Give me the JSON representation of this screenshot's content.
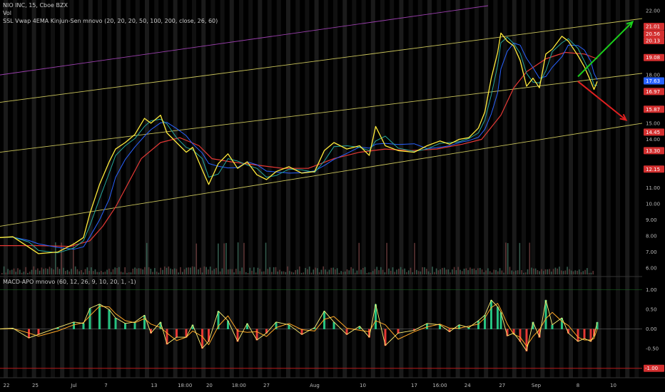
{
  "header": {
    "symbol_line": "NIO INC, 15, Cboe BZX",
    "vol_label": "Vol",
    "indicator_line": "SSL Vwap 4EMA Kinjun-Sen mnovo (20, 20, 20, 50, 100, 200, close, 26, 60)",
    "macd_label": "MACD-APO mnovo (60, 12, 26, 9, 10, 20, 1, -1)"
  },
  "chart_data": {
    "type": "line",
    "price_axis": {
      "ticks": [
        "22.00",
        "21.01",
        "20.56",
        "20.13",
        "19.08",
        "18.00",
        "17.63",
        "16.97",
        "15.87",
        "15.00",
        "14.45",
        "14.00",
        "13.30",
        "12.15",
        "11.00",
        "10.00",
        "9.00",
        "8.00",
        "7.00",
        "6.00"
      ],
      "tag_colors": {
        "21.01": "#d32f2f",
        "20.56": "#d32f2f",
        "20.13": "#d32f2f",
        "19.08": "#d32f2f",
        "17.63": "#2962ff",
        "16.97": "#d32f2f",
        "15.87": "#d32f2f",
        "14.45": "#d32f2f",
        "13.30": "#d32f2f",
        "12.15": "#d32f2f"
      },
      "ylim": [
        5.7,
        22.3
      ]
    },
    "macd_axis": {
      "ticks": [
        "1.00",
        "0.50",
        "0.00",
        "-0.50",
        "-1.00"
      ],
      "tag_colors": {
        "-1.00": "#d32f2f"
      },
      "ylim": [
        -1.15,
        1.15
      ]
    },
    "x_ticks": [
      {
        "label": "22",
        "t": 0.01
      },
      {
        "label": "25",
        "t": 0.055
      },
      {
        "label": "Jul",
        "t": 0.115
      },
      {
        "label": "7",
        "t": 0.165
      },
      {
        "label": "13",
        "t": 0.24
      },
      {
        "label": "18:00",
        "t": 0.288
      },
      {
        "label": "20",
        "t": 0.326
      },
      {
        "label": "18:00",
        "t": 0.372
      },
      {
        "label": "27",
        "t": 0.415
      },
      {
        "label": "Aug",
        "t": 0.49
      },
      {
        "label": "10",
        "t": 0.565
      },
      {
        "label": "17",
        "t": 0.645
      },
      {
        "label": "16:00",
        "t": 0.685
      },
      {
        "label": "24",
        "t": 0.728
      },
      {
        "label": "27",
        "t": 0.782
      },
      {
        "label": "Sep",
        "t": 0.835
      },
      {
        "label": "8",
        "t": 0.9
      },
      {
        "label": "10",
        "t": 0.955
      }
    ],
    "price_series": [
      {
        "t": 0.0,
        "v": 7.9
      },
      {
        "t": 0.02,
        "v": 7.95
      },
      {
        "t": 0.045,
        "v": 7.3
      },
      {
        "t": 0.06,
        "v": 6.9
      },
      {
        "t": 0.09,
        "v": 7.0
      },
      {
        "t": 0.115,
        "v": 7.5
      },
      {
        "t": 0.13,
        "v": 7.9
      },
      {
        "t": 0.14,
        "v": 9.4
      },
      {
        "t": 0.155,
        "v": 11.2
      },
      {
        "t": 0.17,
        "v": 12.6
      },
      {
        "t": 0.18,
        "v": 13.4
      },
      {
        "t": 0.195,
        "v": 13.8
      },
      {
        "t": 0.21,
        "v": 14.3
      },
      {
        "t": 0.225,
        "v": 15.3
      },
      {
        "t": 0.235,
        "v": 15.0
      },
      {
        "t": 0.25,
        "v": 15.5
      },
      {
        "t": 0.26,
        "v": 14.4
      },
      {
        "t": 0.275,
        "v": 13.8
      },
      {
        "t": 0.29,
        "v": 13.2
      },
      {
        "t": 0.3,
        "v": 13.5
      },
      {
        "t": 0.315,
        "v": 12.1
      },
      {
        "t": 0.325,
        "v": 11.2
      },
      {
        "t": 0.34,
        "v": 12.5
      },
      {
        "t": 0.355,
        "v": 13.1
      },
      {
        "t": 0.37,
        "v": 12.2
      },
      {
        "t": 0.385,
        "v": 12.6
      },
      {
        "t": 0.4,
        "v": 11.8
      },
      {
        "t": 0.415,
        "v": 11.5
      },
      {
        "t": 0.43,
        "v": 12.0
      },
      {
        "t": 0.45,
        "v": 12.3
      },
      {
        "t": 0.47,
        "v": 11.9
      },
      {
        "t": 0.49,
        "v": 12.0
      },
      {
        "t": 0.505,
        "v": 13.3
      },
      {
        "t": 0.52,
        "v": 13.8
      },
      {
        "t": 0.54,
        "v": 13.4
      },
      {
        "t": 0.56,
        "v": 13.6
      },
      {
        "t": 0.575,
        "v": 13.0
      },
      {
        "t": 0.585,
        "v": 14.8
      },
      {
        "t": 0.6,
        "v": 13.6
      },
      {
        "t": 0.62,
        "v": 13.3
      },
      {
        "t": 0.645,
        "v": 13.2
      },
      {
        "t": 0.665,
        "v": 13.6
      },
      {
        "t": 0.685,
        "v": 13.9
      },
      {
        "t": 0.7,
        "v": 13.7
      },
      {
        "t": 0.715,
        "v": 14.0
      },
      {
        "t": 0.73,
        "v": 14.1
      },
      {
        "t": 0.745,
        "v": 14.7
      },
      {
        "t": 0.755,
        "v": 15.7
      },
      {
        "t": 0.765,
        "v": 17.8
      },
      {
        "t": 0.775,
        "v": 19.4
      },
      {
        "t": 0.78,
        "v": 20.6
      },
      {
        "t": 0.79,
        "v": 20.1
      },
      {
        "t": 0.8,
        "v": 19.8
      },
      {
        "t": 0.81,
        "v": 18.9
      },
      {
        "t": 0.82,
        "v": 17.3
      },
      {
        "t": 0.83,
        "v": 17.8
      },
      {
        "t": 0.84,
        "v": 17.2
      },
      {
        "t": 0.85,
        "v": 19.3
      },
      {
        "t": 0.86,
        "v": 19.6
      },
      {
        "t": 0.875,
        "v": 20.4
      },
      {
        "t": 0.885,
        "v": 20.1
      },
      {
        "t": 0.9,
        "v": 19.2
      },
      {
        "t": 0.91,
        "v": 18.5
      },
      {
        "t": 0.92,
        "v": 17.6
      },
      {
        "t": 0.925,
        "v": 17.1
      },
      {
        "t": 0.93,
        "v": 17.6
      }
    ],
    "ma_series": [
      {
        "t": 0.0,
        "v": 7.4
      },
      {
        "t": 0.06,
        "v": 7.4
      },
      {
        "t": 0.11,
        "v": 7.35
      },
      {
        "t": 0.14,
        "v": 7.7
      },
      {
        "t": 0.16,
        "v": 8.6
      },
      {
        "t": 0.18,
        "v": 9.8
      },
      {
        "t": 0.2,
        "v": 11.3
      },
      {
        "t": 0.22,
        "v": 12.8
      },
      {
        "t": 0.25,
        "v": 13.8
      },
      {
        "t": 0.28,
        "v": 14.1
      },
      {
        "t": 0.31,
        "v": 13.6
      },
      {
        "t": 0.33,
        "v": 12.8
      },
      {
        "t": 0.36,
        "v": 12.6
      },
      {
        "t": 0.4,
        "v": 12.4
      },
      {
        "t": 0.44,
        "v": 12.2
      },
      {
        "t": 0.48,
        "v": 12.2
      },
      {
        "t": 0.52,
        "v": 12.8
      },
      {
        "t": 0.56,
        "v": 13.2
      },
      {
        "t": 0.6,
        "v": 13.4
      },
      {
        "t": 0.64,
        "v": 13.3
      },
      {
        "t": 0.68,
        "v": 13.4
      },
      {
        "t": 0.72,
        "v": 13.7
      },
      {
        "t": 0.75,
        "v": 14.0
      },
      {
        "t": 0.78,
        "v": 15.5
      },
      {
        "t": 0.8,
        "v": 17.2
      },
      {
        "t": 0.82,
        "v": 18.2
      },
      {
        "t": 0.85,
        "v": 19.0
      },
      {
        "t": 0.88,
        "v": 19.4
      },
      {
        "t": 0.91,
        "v": 19.3
      },
      {
        "t": 0.93,
        "v": 19.0
      }
    ],
    "channel_lines": [
      {
        "name": "",
        "color": "#c9c35a",
        "t0": 0.0,
        "v0": 16.3,
        "t1": 1.0,
        "v1": 21.5
      },
      {
        "name": "",
        "color": "#c9c35a",
        "t0": 0.0,
        "v0": 13.2,
        "t1": 1.0,
        "v1": 18.1
      },
      {
        "name": "",
        "color": "#c9c35a",
        "t0": 0.0,
        "v0": 8.6,
        "t1": 1.0,
        "v1": 15.0
      },
      {
        "name": "",
        "color": "#9b3fae",
        "t0": 0.0,
        "v0": 18.0,
        "t1": 0.76,
        "v1": 22.3
      }
    ],
    "arrows": [
      {
        "color": "#1bd11b",
        "t0": 0.9,
        "v0": 17.9,
        "t1": 0.985,
        "v1": 21.3
      },
      {
        "color": "#e02020",
        "t0": 0.9,
        "v0": 17.6,
        "t1": 0.975,
        "v1": 15.2
      }
    ]
  }
}
